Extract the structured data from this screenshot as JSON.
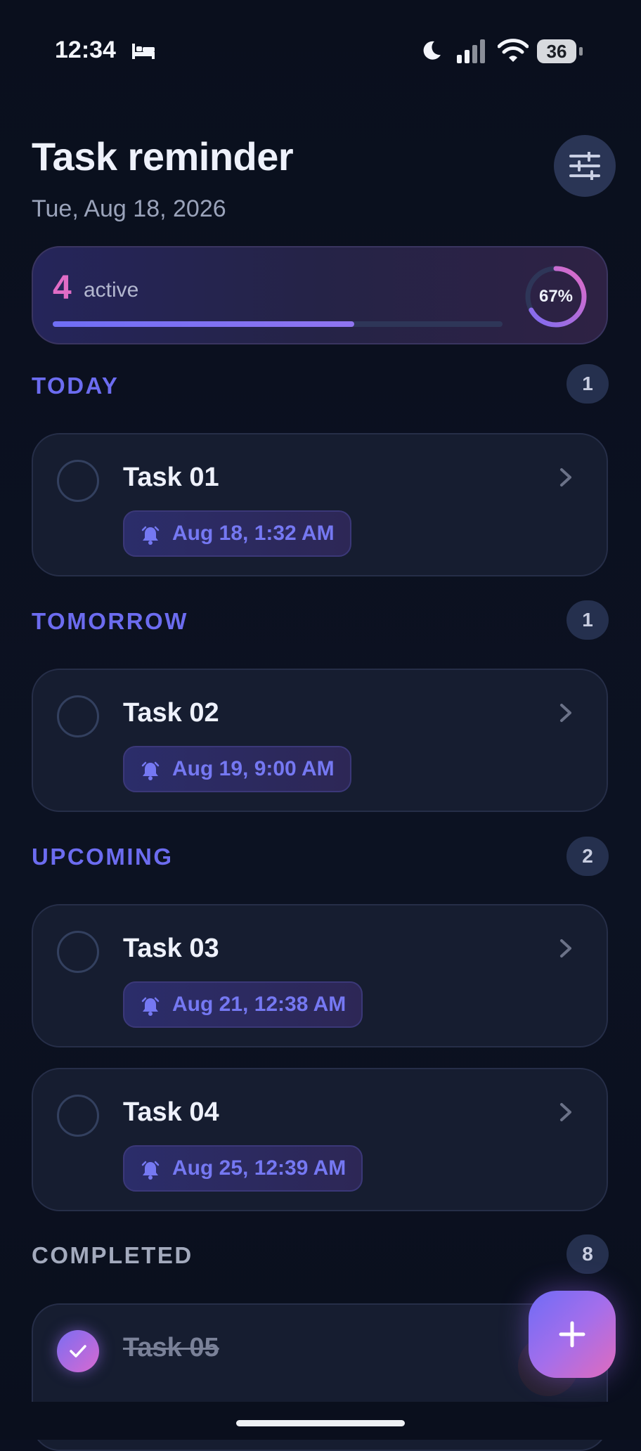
{
  "status_bar": {
    "time": "12:34",
    "battery": "36",
    "icons": [
      "bed-icon",
      "moon-icon",
      "signal-icon",
      "wifi-icon",
      "battery-icon"
    ]
  },
  "header": {
    "title": "Task reminder",
    "date": "Tue, Aug 18, 2026",
    "filter_icon": "sliders-icon"
  },
  "summary": {
    "active_count": "4",
    "active_label": "active",
    "progress_text": "67%",
    "progress_value": 0.67
  },
  "sections": [
    {
      "title": "TODAY",
      "count": "1",
      "tasks": [
        {
          "name": "Task 01",
          "reminder": "Aug 18, 1:32 AM"
        }
      ]
    },
    {
      "title": "TOMORROW",
      "count": "1",
      "tasks": [
        {
          "name": "Task 02",
          "reminder": "Aug 19, 9:00 AM"
        }
      ]
    },
    {
      "title": "UPCOMING",
      "count": "2",
      "tasks": [
        {
          "name": "Task 03",
          "reminder": "Aug 21, 12:38 AM"
        },
        {
          "name": "Task 04",
          "reminder": "Aug 25, 12:39 AM"
        }
      ]
    },
    {
      "title": "COMPLETED",
      "count": "8",
      "tasks": [
        {
          "name": "Task 05"
        }
      ]
    }
  ],
  "fab": {
    "icon": "plus-icon"
  },
  "colors": {
    "accent": "#6c6cf0",
    "pink": "#e06cc6",
    "background": "#0b1020",
    "card": "#161d30"
  }
}
